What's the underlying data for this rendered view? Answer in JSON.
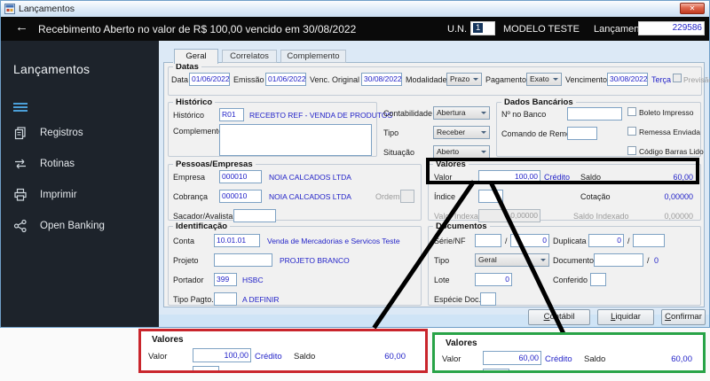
{
  "titlebar": {
    "title": "Lançamentos",
    "close": "✕"
  },
  "header": {
    "back": "←",
    "title": "Recebimento Aberto no valor de R$ 100,00 vencido em 30/08/2022",
    "un_label": "U.N.",
    "un_value": "1",
    "un_name": "MODELO TESTE",
    "lanc_label": "Lançamento",
    "lanc_value": "229586"
  },
  "sidebar": {
    "title": "Lançamentos",
    "items": [
      {
        "label": "Registros"
      },
      {
        "label": "Rotinas"
      },
      {
        "label": "Imprimir"
      },
      {
        "label": "Open Banking"
      }
    ]
  },
  "tabs": {
    "geral": "Geral",
    "correlatos": "Correlatos",
    "complemento": "Complemento"
  },
  "datas": {
    "title": "Datas",
    "data_label": "Data",
    "data_value": "01/06/2022",
    "emissao_label": "Emissão",
    "emissao_value": "01/06/2022",
    "venc_orig_label": "Venc. Original",
    "venc_orig_value": "30/08/2022",
    "modalidade_label": "Modalidade",
    "modalidade_value": "Prazo",
    "pagamento_label": "Pagamento",
    "pagamento_value": "Exato",
    "vencimento_label": "Vencimento",
    "vencimento_value": "30/08/2022",
    "weekday": "Terça",
    "previsao_label": "Previsão"
  },
  "historico": {
    "title": "Histórico",
    "historico_label": "Histórico",
    "codigo": "R01",
    "descricao": "RECEBTO REF - VENDA DE PRODUTOS",
    "complemento_label": "Complemento",
    "complemento_value": ""
  },
  "classificacao": {
    "contabilidade_label": "Contabilidade",
    "contabilidade_value": "Abertura",
    "tipo_label": "Tipo",
    "tipo_value": "Receber",
    "situacao_label": "Situação",
    "situacao_value": "Aberto"
  },
  "dados_bancarios": {
    "title": "Dados Bancários",
    "num_banco_label": "Nº no Banco",
    "num_banco_value": "",
    "comando_label": "Comando de Remessa",
    "comando_value": "",
    "checks": [
      {
        "label": "Boleto Impresso"
      },
      {
        "label": "Remessa Enviada"
      },
      {
        "label": "Código Barras Lido"
      }
    ]
  },
  "pessoas": {
    "title": "Pessoas/Empresas",
    "empresa_label": "Empresa",
    "empresa_codigo": "000010",
    "empresa_nome": "NOIA CALCADOS LTDA",
    "cobranca_label": "Cobrança",
    "cobranca_codigo": "000010",
    "cobranca_nome": "NOIA CALCADOS LTDA",
    "ordem_label": "Ordem",
    "sacador_label": "Sacador/Avalista",
    "sacador_value": ""
  },
  "valores": {
    "title": "Valores",
    "valor_label": "Valor",
    "valor_value": "100,00",
    "credito": "Crédito",
    "saldo_label": "Saldo",
    "saldo_value": "60,00",
    "indice_label": "Índice",
    "indice_value": "",
    "cotacao_label": "Cotação",
    "cotacao_value": "0,00000",
    "valor_indexado_label": "Valor Indexado",
    "valor_indexado_value": "0,00000",
    "saldo_indexado_label": "Saldo Indexado",
    "saldo_indexado_value": "0,00000"
  },
  "identificacao": {
    "title": "Identificação",
    "conta_label": "Conta",
    "conta_codigo": "10.01.01",
    "conta_desc": "Venda de Mercadorias e Servicos Teste",
    "projeto_label": "Projeto",
    "projeto_value": "",
    "projeto_desc": "PROJETO BRANCO",
    "portador_label": "Portador",
    "portador_codigo": "399",
    "portador_desc": "HSBC",
    "tipo_pagto_label": "Tipo Pagto.",
    "tipo_pagto_value": "",
    "tipo_pagto_desc": "A DEFINIR"
  },
  "documentos": {
    "title": "Documentos",
    "serie_label": "Série/NF",
    "serie_value": "",
    "slash": "/",
    "nf_value": "0",
    "duplicata_label": "Duplicata",
    "duplicata_value": "0",
    "dup2_value": "",
    "tipo_label": "Tipo",
    "tipo_value": "Geral",
    "documento_label": "Documento",
    "documento_value": "",
    "documento_num": "0",
    "lote_label": "Lote",
    "lote_value": "0",
    "conferido_label": "Conferido",
    "conferido_value": "",
    "especie_label": "Espécie Doc.",
    "especie_value": ""
  },
  "footer": {
    "contabil": "Contábil",
    "liquidar": "Liquidar",
    "confirmar": "Confirmar"
  },
  "callouts": {
    "red": {
      "title": "Valores",
      "valor_label": "Valor",
      "valor_value": "100,00",
      "credito": "Crédito",
      "saldo_label": "Saldo",
      "saldo_value": "60,00"
    },
    "green": {
      "title": "Valores",
      "valor_label": "Valor",
      "valor_value": "60,00",
      "credito": "Crédito",
      "saldo_label": "Saldo",
      "saldo_value": "60,00"
    }
  },
  "colors": {
    "value_blue": "#2323c8",
    "highlight_red": "#c9252c",
    "highlight_green": "#28a347",
    "annotation_black": "#000000",
    "sidebar_bg": "#1d232b"
  }
}
